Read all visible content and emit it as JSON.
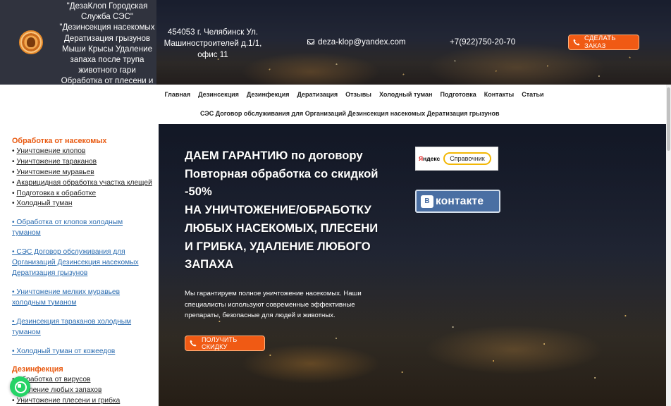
{
  "header": {
    "site_title": "\"ДезаКлоп Городская Служба СЭС\" \"Дезинсекция насекомых Дератизация грызунов Мыши Крысы Удаление запаха после трупа животного гари Обработка от плесени и грибка\"",
    "address": "454053 г. Челябинск Ул. Машиностроителей д.1/1, офис 11",
    "email": "deza-klop@yandex.com",
    "phone": "+7(922)750-20-70",
    "order_button": "СДЕЛАТЬ ЗАКАЗ"
  },
  "nav": {
    "items": [
      "Главная",
      "Дезинсекция",
      "Дезинфекция",
      "Дератизация",
      "Отзывы",
      "Холодный туман",
      "Подготовка",
      "Контакты",
      "Статьи"
    ],
    "second_row": "СЭС Договор обслуживания для Организаций Дезинсекция насекомых Дератизация грызунов"
  },
  "sidebar": {
    "section1_title": "Обработка от насекомых",
    "section1_items": [
      "Уничтожение клопов",
      "Уничтожение тараканов",
      "Уничтожение муравьев",
      "Акарицидная обработка участка клещей",
      "Подготовка к обработке",
      "Холодный туман"
    ],
    "links": [
      "• Обработка от клопов  холодным туманом",
      "• СЭС Договор обслуживания для Организаций Дезинсекция насекомых Дератизация грызунов",
      "• Уничтожение мелких муравьев холодным туманом",
      "• Дезинсекция тараканов холодным туманом",
      "• Холодный туман от кожеедов"
    ],
    "section2_title": "Дезинфекция",
    "section2_items": [
      "Обработка от вирусов",
      "Удаление любых запахов",
      "Уничтожение плесени и грибка"
    ]
  },
  "hero": {
    "title_lines": [
      "ДАЕМ ГАРАНТИЮ по договору",
      "Повторная обработка со скидкой",
      "-50%",
      "НА УНИЧТОЖЕНИЕ/ОБРАБОТКУ",
      "ЛЮБЫХ НАСЕКОМЫХ, ПЛЕСЕНИ",
      "И ГРИБКА, УДАЛЕНИЕ ЛЮБОГО",
      "ЗАПАХА"
    ],
    "text": "Мы гарантируем полное уничтожение насекомых. Наши специалисты используют современные эффективные препараты, безопасные для людей и животных.",
    "promo_button": "ПОЛУЧИТЬ СКИДКУ",
    "yandex_logo_red": "Я",
    "yandex_logo_rest": "ндекс",
    "yandex_label": "Справочник",
    "vk_icon_text": "В",
    "vk_text": "контакте"
  },
  "colors": {
    "accent_orange": "#f05a14",
    "sidebar_heading": "#e8580e",
    "link_blue": "#2b6cb0",
    "vk_blue": "#4a6fa3",
    "whatsapp_green": "#25d366"
  },
  "icons": {
    "logo": "pest-control-logo-icon",
    "email": "envelope-icon",
    "phone": "phone-icon",
    "whatsapp": "whatsapp-icon"
  }
}
